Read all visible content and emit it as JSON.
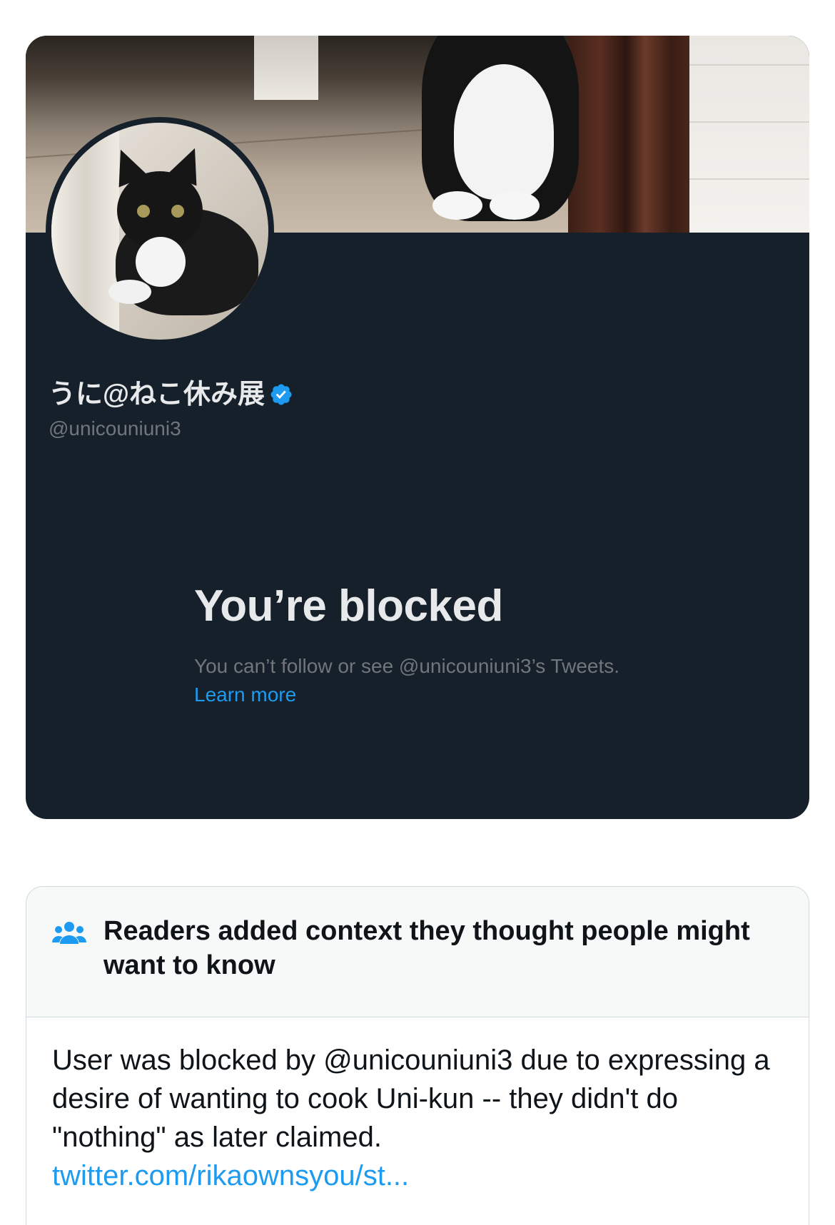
{
  "profile": {
    "display_name": "うに@ねこ休み展",
    "handle": "@unicouniuni3",
    "verified_icon": "verified-badge-icon",
    "avatar_icon": "avatar-cat-photo",
    "banner_icon": "banner-cat-photo"
  },
  "blocked": {
    "title": "You’re blocked",
    "description": "You can’t follow or see @unicouniuni3’s Tweets.",
    "learn_more": "Learn more"
  },
  "notes": {
    "icon": "readers-icon",
    "title": "Readers added context they thought people might want to know",
    "body": "User was blocked by @unicouniuni3 due to expressing a desire of wanting to cook Uni-kun -- they didn't do \"nothing\" as later claimed.",
    "link": "twitter.com/rikaownsyou/st..."
  },
  "colors": {
    "card_bg": "#16202b",
    "accent": "#1d9bf0",
    "muted": "#71767b"
  }
}
